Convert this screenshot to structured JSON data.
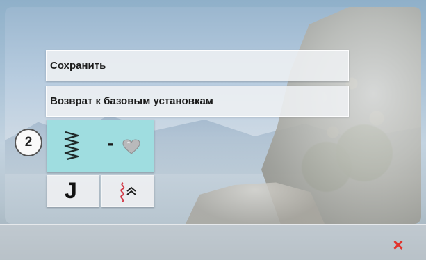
{
  "menu": {
    "save_label": "Сохранить",
    "reset_label": "Возврат к базовым установкам"
  },
  "callout": {
    "number": "2"
  },
  "stitch_selection": {
    "separator": "-",
    "stitch_icon": "zigzag-stitch-icon",
    "pattern_icon": "heart-stitch-icon"
  },
  "buttons": {
    "j_label": "J",
    "stitch_icon": "decorative-stitch-icon"
  },
  "close": {
    "symbol": "×",
    "color": "#e2332c"
  },
  "colors": {
    "selection": "#9fdde0",
    "close": "#e2332c"
  }
}
